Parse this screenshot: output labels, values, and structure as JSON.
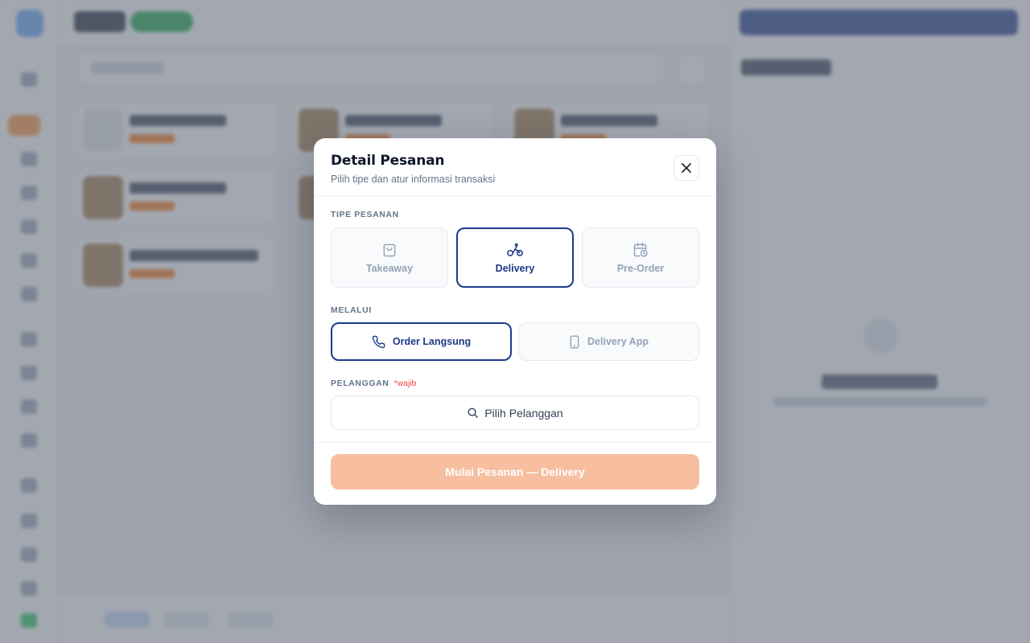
{
  "modal": {
    "title": "Detail Pesanan",
    "subtitle": "Pilih tipe dan atur informasi transaksi",
    "order_type": {
      "label": "TIPE PESANAN",
      "options": [
        {
          "label": "Takeaway",
          "icon": "shopping-bag-icon",
          "selected": false
        },
        {
          "label": "Delivery",
          "icon": "bike-icon",
          "selected": true
        },
        {
          "label": "Pre-Order",
          "icon": "calendar-clock-icon",
          "selected": false
        }
      ]
    },
    "via": {
      "label": "MELALUI",
      "options": [
        {
          "label": "Order Langsung",
          "icon": "phone-icon",
          "selected": true
        },
        {
          "label": "Delivery App",
          "icon": "smartphone-icon",
          "selected": false
        }
      ]
    },
    "customer": {
      "label": "PELANGGAN",
      "required_note": "*wajib",
      "button_label": "Pilih Pelanggan"
    },
    "submit_label": "Mulai Pesanan — Delivery",
    "submit_enabled": false
  },
  "colors": {
    "primary": "#1e3a8a",
    "accent_disabled": "#f7bea0",
    "required": "#ef4444",
    "muted": "#94a3b8"
  }
}
